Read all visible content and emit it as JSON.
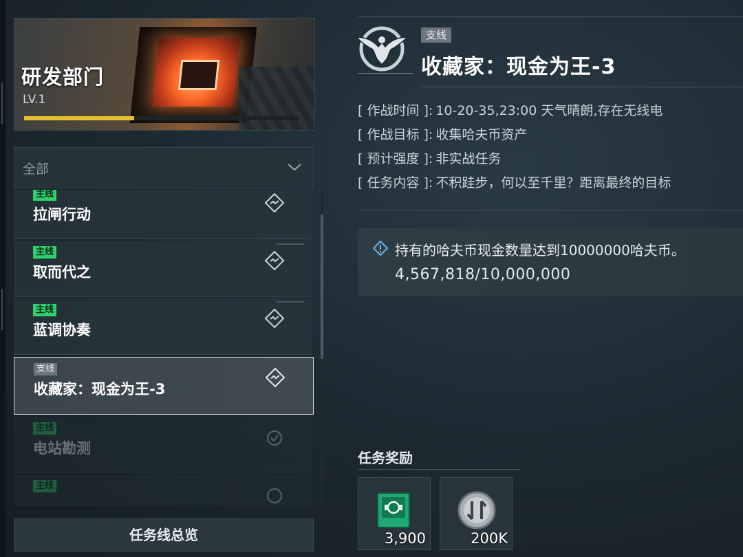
{
  "department": {
    "title": "研发部门",
    "level": "LV.1",
    "level_progress": 0.4
  },
  "filter": {
    "selected": "全部"
  },
  "missions": [
    {
      "tag": "主线",
      "tag_type": "main",
      "name": "拉闸行动"
    },
    {
      "tag": "主线",
      "tag_type": "main",
      "name": "取而代之"
    },
    {
      "tag": "主线",
      "tag_type": "main",
      "name": "蓝调协奏"
    },
    {
      "tag": "支线",
      "tag_type": "branch",
      "name": "收藏家：现金为王-3",
      "selected": true
    },
    {
      "tag": "主线",
      "tag_type": "main",
      "name": "电站勘测",
      "completed": true
    },
    {
      "tag": "主线",
      "tag_type": "main",
      "name": ""
    }
  ],
  "overview_button": "任务线总览",
  "detail": {
    "tag": "支线",
    "title": "收藏家：现金为王-3",
    "info": [
      {
        "key": "[ 作战时间 ]:",
        "value": "10-20-35,23:00 天气晴朗,存在无线电"
      },
      {
        "key": "[ 作战目标 ]:",
        "value": "收集哈夫币资产"
      },
      {
        "key": "[ 预计强度 ]:",
        "value": "非实战任务"
      },
      {
        "key": "[ 任务内容 ]:",
        "value": "不积跬步，何以至千里？距离最终的目标"
      }
    ],
    "objective_text": "持有的哈夫币现金数量达到10000000哈夫币。",
    "objective_progress": "4,567,818/10,000,000",
    "reward_title": "任务奖励",
    "rewards": [
      {
        "icon": "green-chip-icon",
        "amount": "3,900"
      },
      {
        "icon": "silver-coin-icon",
        "amount": "200K"
      }
    ]
  },
  "colors": {
    "main_tag": "#2fd06e",
    "branch_tag": "#6c767c",
    "level_bar": "#e6c12f"
  }
}
